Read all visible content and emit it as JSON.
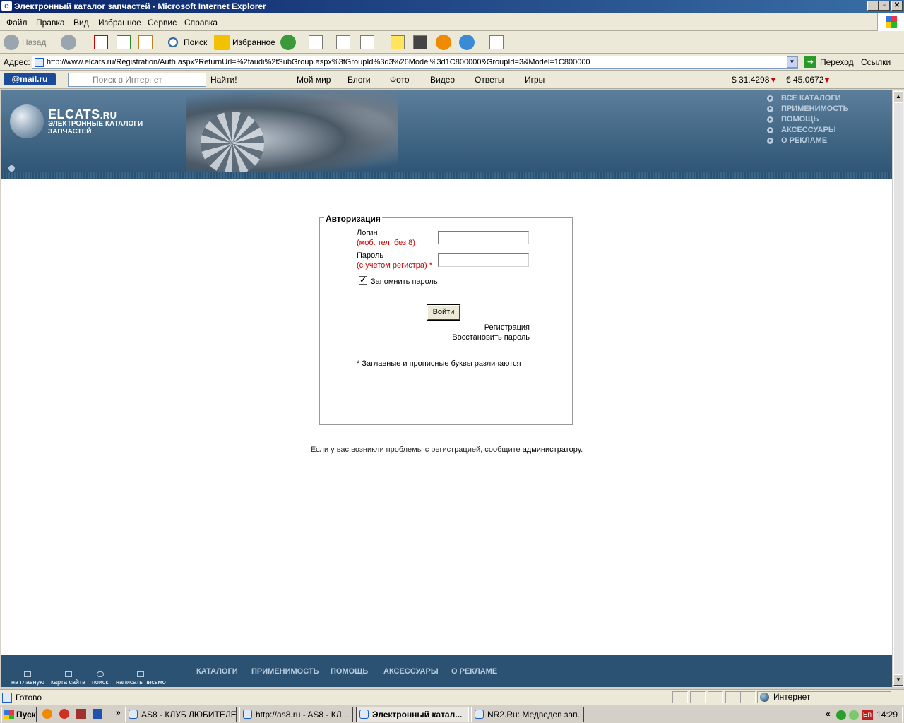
{
  "window": {
    "title": "Электронный каталог запчастей - Microsoft Internet Explorer"
  },
  "menu": [
    "Файл",
    "Правка",
    "Вид",
    "Избранное",
    "Сервис",
    "Справка"
  ],
  "toolbar": {
    "back": "Назад",
    "search": "Поиск",
    "favorites": "Избранное"
  },
  "address": {
    "label": "Адрес:",
    "url": "http://www.elcats.ru/Registration/Auth.aspx?ReturnUrl=%2faudi%2fSubGroup.aspx%3fGroupId%3d3%26Model%3d1C800000&GroupId=3&Model=1C800000",
    "go": "Переход",
    "links": "Ссылки"
  },
  "mailbar": {
    "logo": "@mail.ru",
    "search_placeholder": "Поиск в Интернет",
    "find": "Найти!",
    "items": [
      "Мой мир",
      "Блоги",
      "Фото",
      "Видео",
      "Ответы",
      "Игры"
    ],
    "usd": "$ 31.4298",
    "eur": "€ 45.0672"
  },
  "site": {
    "brand": "ELCATS",
    "brand_tld": ".RU",
    "brand_sub": "Электронные каталоги запчастей",
    "topnav": [
      "Все каталоги",
      "Применимость",
      "Помощь",
      "Аксессуары",
      "О рекламе"
    ],
    "auth": {
      "legend": "Авторизация",
      "login_label": "Логин",
      "login_hint": "(моб. тел. без 8)",
      "password_label": "Пароль",
      "password_hint": "(с учетом регистра) *",
      "remember": "Запомнить пароль",
      "remember_checked": true,
      "login_button": "Войти",
      "register": "Регистрация",
      "restore": "Восстановить пароль",
      "note": "* Заглавные и прописные буквы различаются"
    },
    "problem_text": "Если у вас возникли проблемы с регистрацией, сообщите ",
    "problem_link": "администратору",
    "problem_end": ".",
    "footer_icons": [
      "на главную",
      "карта сайта",
      "поиск",
      "написать письмо"
    ],
    "footer_nav": [
      "Каталоги",
      "Применимость",
      "Помощь",
      "Аксессуары",
      "О рекламе"
    ]
  },
  "status": {
    "text": "Готово",
    "zone": "Интернет"
  },
  "taskbar": {
    "start": "Пуск",
    "tasks": [
      "AS8 - КЛУБ ЛЮБИТЕЛЕ...",
      "http://as8.ru - AS8 - КЛ...",
      "Электронный катал...",
      "NR2.Ru: Медведев зап..."
    ],
    "clock": "14:29",
    "lang": "En"
  },
  "colors": {
    "header": "#3e6482",
    "footer": "#2c5273",
    "hint": "#cc0000",
    "nav": "#b8ccdd"
  }
}
